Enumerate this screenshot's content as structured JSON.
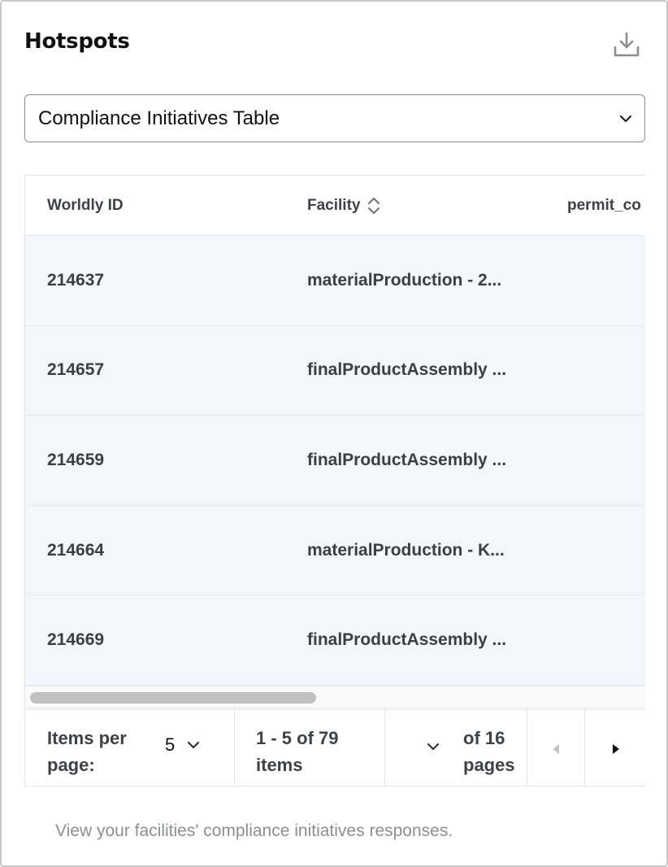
{
  "header": {
    "title": "Hotspots"
  },
  "dropdown": {
    "selected": "Compliance Initiatives Table"
  },
  "table": {
    "columns": [
      "Worldly ID",
      "Facility",
      "permit_co"
    ],
    "rows": [
      {
        "id": "214637",
        "facility": "materialProduction - 2..."
      },
      {
        "id": "214657",
        "facility": "finalProductAssembly ..."
      },
      {
        "id": "214659",
        "facility": "finalProductAssembly ..."
      },
      {
        "id": "214664",
        "facility": "materialProduction - K..."
      },
      {
        "id": "214669",
        "facility": "finalProductAssembly ..."
      }
    ]
  },
  "pagination": {
    "items_per_page_label": "Items per page:",
    "items_per_page_value": "5",
    "range_text": "1 - 5 of 79 items",
    "pages_text": "of 16 pages"
  },
  "footer": {
    "description": "View your facilities' compliance initiatives responses."
  },
  "colors": {
    "row_background": "#f3f6fc",
    "border": "#e3e6ea",
    "muted_text": "#8a8f96"
  },
  "icons": [
    "download-icon",
    "chevron-down-icon",
    "sort-icon",
    "chevron-left-icon",
    "chevron-right-icon"
  ]
}
